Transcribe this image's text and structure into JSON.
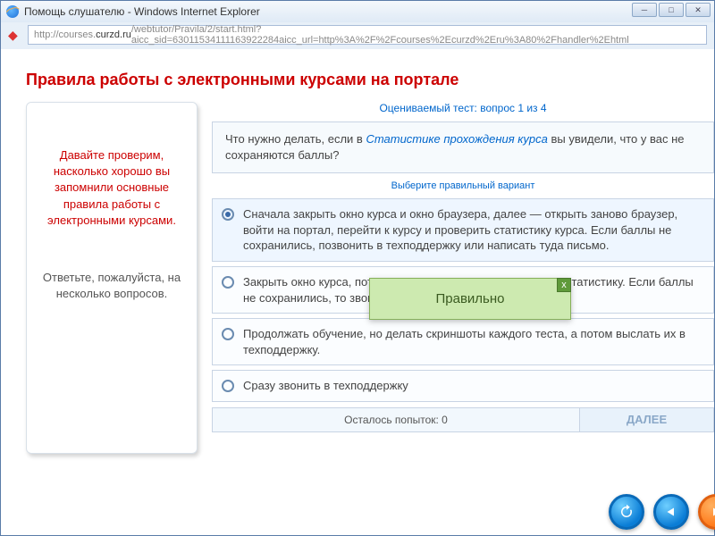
{
  "window": {
    "title": "Помощь слушателю - Windows Internet Explorer"
  },
  "url": {
    "scheme": "http://",
    "prefix": "courses.",
    "host": "curzd.ru",
    "path": "/webtutor/Pravila/2/start.html?aicc_sid=63011534111163922284aicc_url=http%3A%2F%2Fcourses%2Ecurzd%2Eru%3A80%2Fhandler%2Ehtml"
  },
  "course": {
    "title": "Правила работы с электронными  курсами на портале"
  },
  "left": {
    "red": "Давайте проверим, насколько хорошо вы запомнили основные правила работы с электронными курсами.",
    "gray": "Ответьте, пожалуйста, на несколько вопросов."
  },
  "quiz": {
    "meta": "Оцениваемый тест: вопрос 1 из 4",
    "question_pre": "Что нужно делать, если в ",
    "question_link": "Статистике прохождения курса",
    "question_post": " вы увидели, что у вас не сохраняются баллы?",
    "instruction": "Выберите правильный вариант",
    "options": [
      "Сначала закрыть окно курса и окно браузера, далее — открыть заново браузер, войти на портал, перейти к курсу и проверить статистику курса. Если баллы не сохранились, позвонить в техподдержку или написать туда письмо.",
      "Закрыть окно курса, потом снова его открыть и посмотреть статистику. Если баллы не сохранились, то звонить в техподдержку.",
      "Продолжать обучение, но делать скриншоты каждого теста, а потом выслать их в техподдержку.",
      "Сразу звонить в техподдержку"
    ],
    "selected": 0,
    "attempts": "Осталось попыток: 0",
    "next": "ДАЛЕЕ"
  },
  "feedback": {
    "text": "Правильно",
    "close": "x"
  }
}
